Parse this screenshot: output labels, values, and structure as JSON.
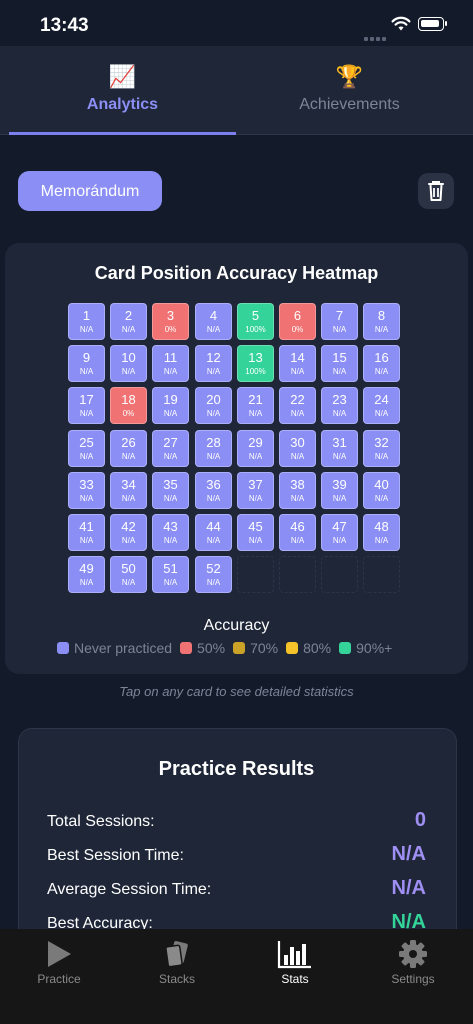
{
  "status": {
    "time": "13:43"
  },
  "tabs": [
    {
      "label": "Analytics",
      "icon": "chart-icon",
      "glyph": "📈",
      "active": true
    },
    {
      "label": "Achievements",
      "icon": "trophy-icon",
      "glyph": "🏆",
      "active": false
    }
  ],
  "deck": {
    "label": "Memorándum"
  },
  "heatmap": {
    "title": "Card Position Accuracy Heatmap",
    "cells": [
      {
        "n": "1",
        "p": "N/A",
        "s": "blue"
      },
      {
        "n": "2",
        "p": "N/A",
        "s": "blue"
      },
      {
        "n": "3",
        "p": "0%",
        "s": "red"
      },
      {
        "n": "4",
        "p": "N/A",
        "s": "blue"
      },
      {
        "n": "5",
        "p": "100%",
        "s": "green"
      },
      {
        "n": "6",
        "p": "0%",
        "s": "red"
      },
      {
        "n": "7",
        "p": "N/A",
        "s": "blue"
      },
      {
        "n": "8",
        "p": "N/A",
        "s": "blue"
      },
      {
        "n": "9",
        "p": "N/A",
        "s": "blue"
      },
      {
        "n": "10",
        "p": "N/A",
        "s": "blue"
      },
      {
        "n": "11",
        "p": "N/A",
        "s": "blue"
      },
      {
        "n": "12",
        "p": "N/A",
        "s": "blue"
      },
      {
        "n": "13",
        "p": "100%",
        "s": "green"
      },
      {
        "n": "14",
        "p": "N/A",
        "s": "blue"
      },
      {
        "n": "15",
        "p": "N/A",
        "s": "blue"
      },
      {
        "n": "16",
        "p": "N/A",
        "s": "blue"
      },
      {
        "n": "17",
        "p": "N/A",
        "s": "blue"
      },
      {
        "n": "18",
        "p": "0%",
        "s": "red"
      },
      {
        "n": "19",
        "p": "N/A",
        "s": "blue"
      },
      {
        "n": "20",
        "p": "N/A",
        "s": "blue"
      },
      {
        "n": "21",
        "p": "N/A",
        "s": "blue"
      },
      {
        "n": "22",
        "p": "N/A",
        "s": "blue"
      },
      {
        "n": "23",
        "p": "N/A",
        "s": "blue"
      },
      {
        "n": "24",
        "p": "N/A",
        "s": "blue"
      },
      {
        "n": "25",
        "p": "N/A",
        "s": "blue"
      },
      {
        "n": "26",
        "p": "N/A",
        "s": "blue"
      },
      {
        "n": "27",
        "p": "N/A",
        "s": "blue"
      },
      {
        "n": "28",
        "p": "N/A",
        "s": "blue"
      },
      {
        "n": "29",
        "p": "N/A",
        "s": "blue"
      },
      {
        "n": "30",
        "p": "N/A",
        "s": "blue"
      },
      {
        "n": "31",
        "p": "N/A",
        "s": "blue"
      },
      {
        "n": "32",
        "p": "N/A",
        "s": "blue"
      },
      {
        "n": "33",
        "p": "N/A",
        "s": "blue"
      },
      {
        "n": "34",
        "p": "N/A",
        "s": "blue"
      },
      {
        "n": "35",
        "p": "N/A",
        "s": "blue"
      },
      {
        "n": "36",
        "p": "N/A",
        "s": "blue"
      },
      {
        "n": "37",
        "p": "N/A",
        "s": "blue"
      },
      {
        "n": "38",
        "p": "N/A",
        "s": "blue"
      },
      {
        "n": "39",
        "p": "N/A",
        "s": "blue"
      },
      {
        "n": "40",
        "p": "N/A",
        "s": "blue"
      },
      {
        "n": "41",
        "p": "N/A",
        "s": "blue"
      },
      {
        "n": "42",
        "p": "N/A",
        "s": "blue"
      },
      {
        "n": "43",
        "p": "N/A",
        "s": "blue"
      },
      {
        "n": "44",
        "p": "N/A",
        "s": "blue"
      },
      {
        "n": "45",
        "p": "N/A",
        "s": "blue"
      },
      {
        "n": "46",
        "p": "N/A",
        "s": "blue"
      },
      {
        "n": "47",
        "p": "N/A",
        "s": "blue"
      },
      {
        "n": "48",
        "p": "N/A",
        "s": "blue"
      },
      {
        "n": "49",
        "p": "N/A",
        "s": "blue"
      },
      {
        "n": "50",
        "p": "N/A",
        "s": "blue"
      },
      {
        "n": "51",
        "p": "N/A",
        "s": "blue"
      },
      {
        "n": "52",
        "p": "N/A",
        "s": "blue"
      }
    ],
    "empty_slots": 4,
    "accuracy_title": "Accuracy",
    "legend": [
      {
        "label": "Never practiced",
        "color": "#8b8ff5"
      },
      {
        "label": "50%",
        "color": "#f07272"
      },
      {
        "label": "70%",
        "color": "#c9a227"
      },
      {
        "label": "80%",
        "color": "#f5c22a"
      },
      {
        "label": "90%+",
        "color": "#34d399"
      }
    ],
    "hint": "Tap on any card to see detailed statistics"
  },
  "colors": {
    "blue": "#8b8ff5",
    "red": "#f07272",
    "green": "#34d399",
    "value": "#9f8ff2"
  },
  "results": {
    "title": "Practice Results",
    "rows": [
      {
        "label": "Total Sessions:",
        "value": "0"
      },
      {
        "label": "Best Session Time:",
        "value": "N/A"
      },
      {
        "label": "Average Session Time:",
        "value": "N/A"
      },
      {
        "label": "Best Accuracy:",
        "value": "N/A"
      }
    ]
  },
  "bottom_nav": [
    {
      "label": "Practice",
      "icon": "play-icon",
      "active": false
    },
    {
      "label": "Stacks",
      "icon": "cards-icon",
      "active": false
    },
    {
      "label": "Stats",
      "icon": "bar-chart-icon",
      "active": true
    },
    {
      "label": "Settings",
      "icon": "gear-icon",
      "active": false
    }
  ]
}
